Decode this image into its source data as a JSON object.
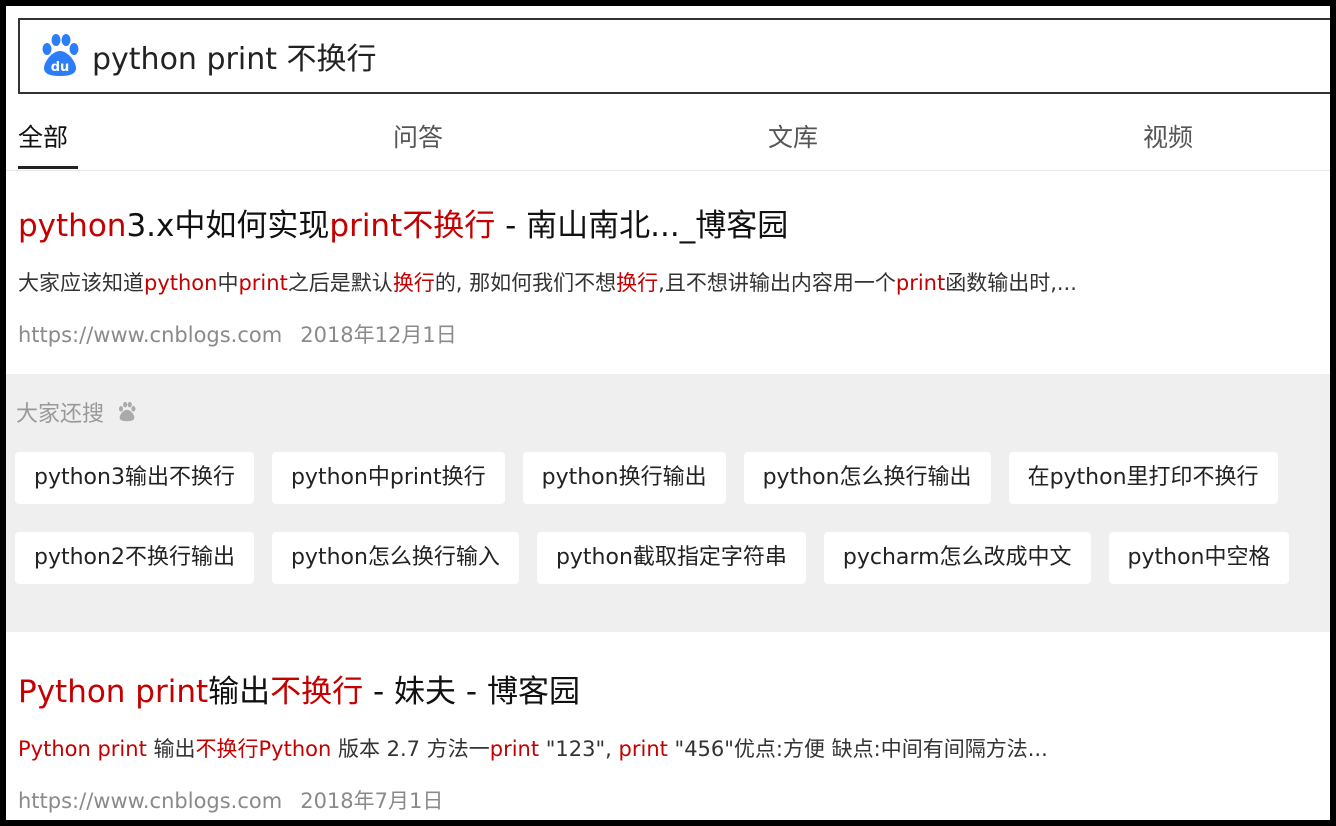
{
  "search": {
    "logo": "baidu-paw-logo",
    "query": "python print 不换行"
  },
  "tabs": [
    {
      "label": "全部",
      "active": true
    },
    {
      "label": "问答"
    },
    {
      "label": "文库"
    },
    {
      "label": "视频"
    }
  ],
  "results": [
    {
      "title": [
        {
          "t": "python",
          "hl": true
        },
        {
          "t": "3.x中如何实现"
        },
        {
          "t": "print不换行",
          "hl": true
        },
        {
          "t": " - 南山南北..._博客园"
        }
      ],
      "snippet": [
        {
          "t": "大家应该知道"
        },
        {
          "t": "python",
          "hl": true
        },
        {
          "t": "中"
        },
        {
          "t": "print",
          "hl": true
        },
        {
          "t": "之后是默认"
        },
        {
          "t": "换行",
          "hl": true
        },
        {
          "t": "的, 那如何我们不想"
        },
        {
          "t": "换行",
          "hl": true
        },
        {
          "t": ",且不想讲输出内容用一个"
        },
        {
          "t": "print",
          "hl": true
        },
        {
          "t": "函数输出时,..."
        }
      ],
      "url": "https://www.cnblogs.com",
      "date": "2018年12月1日"
    },
    {
      "title": [
        {
          "t": "Python print",
          "hl": true
        },
        {
          "t": "输出"
        },
        {
          "t": "不换行",
          "hl": true
        },
        {
          "t": " - 妹夫 - 博客园"
        }
      ],
      "snippet": [
        {
          "t": "Python print",
          "hl": true
        },
        {
          "t": " 输出"
        },
        {
          "t": "不换行Python",
          "hl": true
        },
        {
          "t": " 版本 2.7 方法一"
        },
        {
          "t": "print",
          "hl": true
        },
        {
          "t": " \"123\", "
        },
        {
          "t": "print",
          "hl": true
        },
        {
          "t": " \"456\"优点:方便 缺点:中间有间隔方法..."
        }
      ],
      "url": "https://www.cnblogs.com",
      "date": "2018年7月1日"
    }
  ],
  "related": {
    "title": "大家还搜",
    "icon": "baidu-paw-icon",
    "rows": [
      [
        "python3输出不换行",
        "python中print换行",
        "python换行输出",
        "python怎么换行输出",
        "在python里打印不换行"
      ],
      [
        "python2不换行输出",
        "python怎么换行输入",
        "python截取指定字符串",
        "pycharm怎么改成中文",
        "python中空格"
      ]
    ]
  },
  "colors": {
    "highlight": "#c40000",
    "related_bg": "#efefef",
    "baidu_blue": "#2c7dfa"
  }
}
